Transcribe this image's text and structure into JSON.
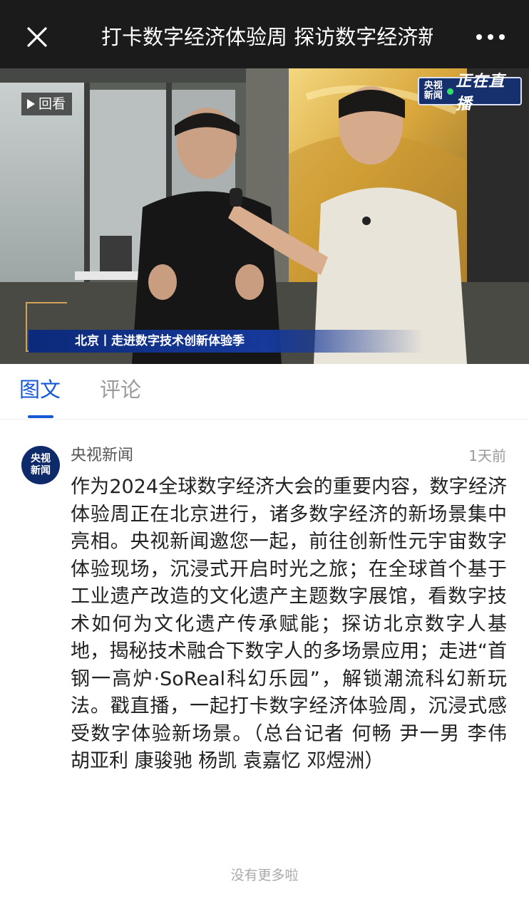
{
  "topbar": {
    "title": "打卡数字经济体验周 探访数字经济新场景",
    "close_icon": "close-icon",
    "more_icon": "more-dots-icon"
  },
  "video": {
    "replay_label": "回看",
    "logo_cctv": [
      "央视",
      "新闻"
    ],
    "logo_live": "正在直播",
    "caption": "北京丨走进数字技术创新体验季"
  },
  "tabs": {
    "items": [
      {
        "label": "图文",
        "active": true
      },
      {
        "label": "评论",
        "active": false
      }
    ],
    "active_color": "#1558d6"
  },
  "post": {
    "avatar_text": [
      "央视",
      "新闻"
    ],
    "author": "央视新闻",
    "time": "1天前",
    "content": "作为2024全球数字经济大会的重要内容，数字经济体验周正在北京进行，诸多数字经济的新场景集中亮相。央视新闻邀您一起，前往创新性元宇宙数字体验现场，沉浸式开启时光之旅；在全球首个基于工业遗产改造的文化遗产主题数字展馆，看数字技术如何为文化遗产传承赋能；探访北京数字人基地，揭秘技术融合下数字人的多场景应用；走进“首钢一高炉·SoReal科幻乐园”，解锁潮流科幻新玩法。戳直播，一起打卡数字经济体验周，沉浸式感受数字体验新场景。（总台记者 何畅 尹一男 李伟 胡亚利 康骏驰 杨凯 袁嘉忆 邓煜洲）"
  },
  "footer": {
    "no_more": "没有更多啦"
  }
}
